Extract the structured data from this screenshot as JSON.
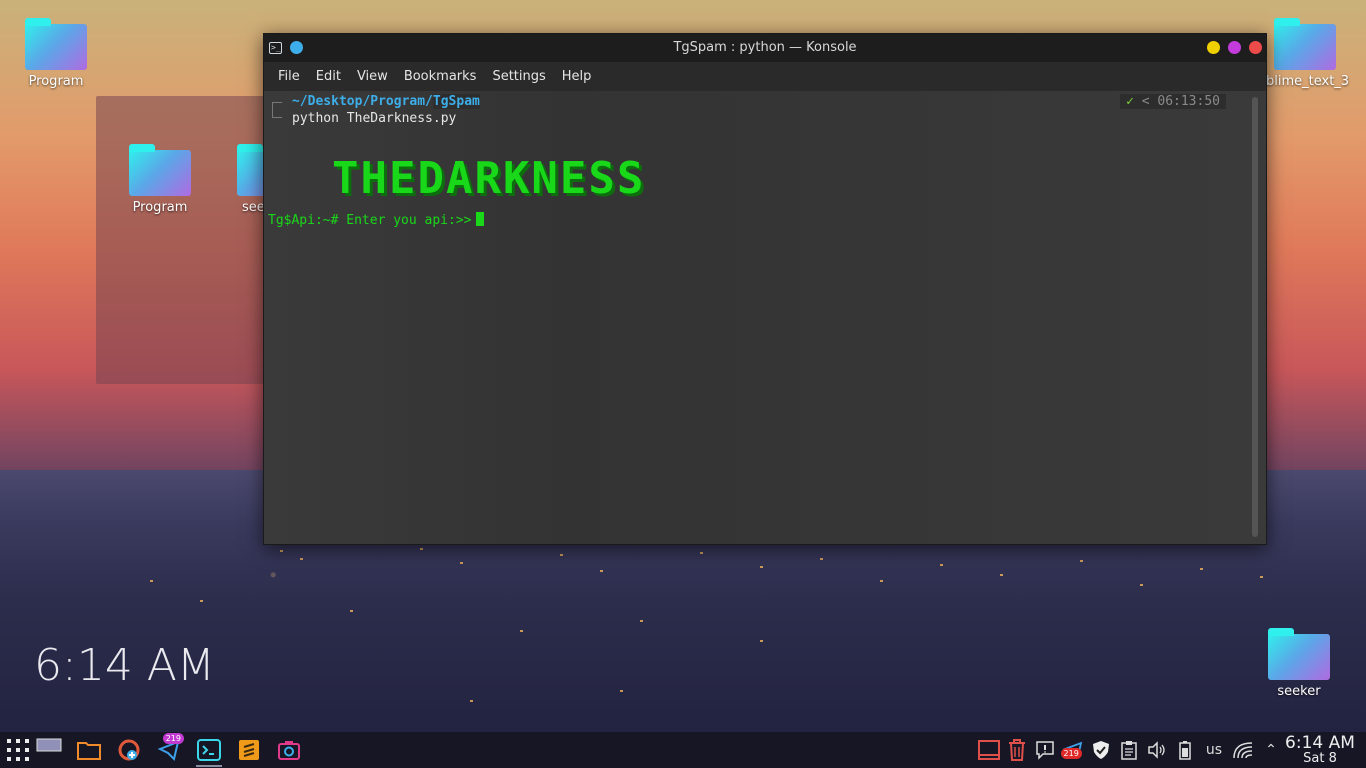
{
  "desktop": {
    "icons": [
      {
        "label": "Program"
      },
      {
        "label": "blime_text_3"
      },
      {
        "label": "seeker"
      }
    ],
    "folder_view": {
      "items": [
        {
          "label": "Program"
        },
        {
          "label": "see"
        }
      ]
    },
    "clock": "6:14 AM"
  },
  "window": {
    "title": "TgSpam : python — Konsole",
    "menu": [
      "File",
      "Edit",
      "View",
      "Bookmarks",
      "Settings",
      "Help"
    ],
    "terminal": {
      "path_prefix": "~/Desktop/Program/",
      "path_dir": "TgSpam",
      "command": "python TheDarkness.py",
      "status_check": "✓",
      "time": "06:13:50",
      "banner": "THEDARKNESS",
      "input_prompt": "Tg$Api:~# Enter you api:>>"
    },
    "colors": {
      "close": "#ed4a4a",
      "maximize": "#c33cdb",
      "minimize": "#f0d000"
    }
  },
  "taskbar": {
    "apps": [
      {
        "name": "app-launcher"
      },
      {
        "name": "pager"
      },
      {
        "name": "file-manager"
      },
      {
        "name": "app-store"
      },
      {
        "name": "telegram",
        "badge": "219"
      },
      {
        "name": "konsole"
      },
      {
        "name": "sublime-text"
      },
      {
        "name": "screenshot"
      }
    ],
    "tray": {
      "telegram_badge": "219",
      "keyboard_layout": "us"
    },
    "clock": {
      "time": "6:14 AM",
      "date": "Sat 8"
    }
  }
}
